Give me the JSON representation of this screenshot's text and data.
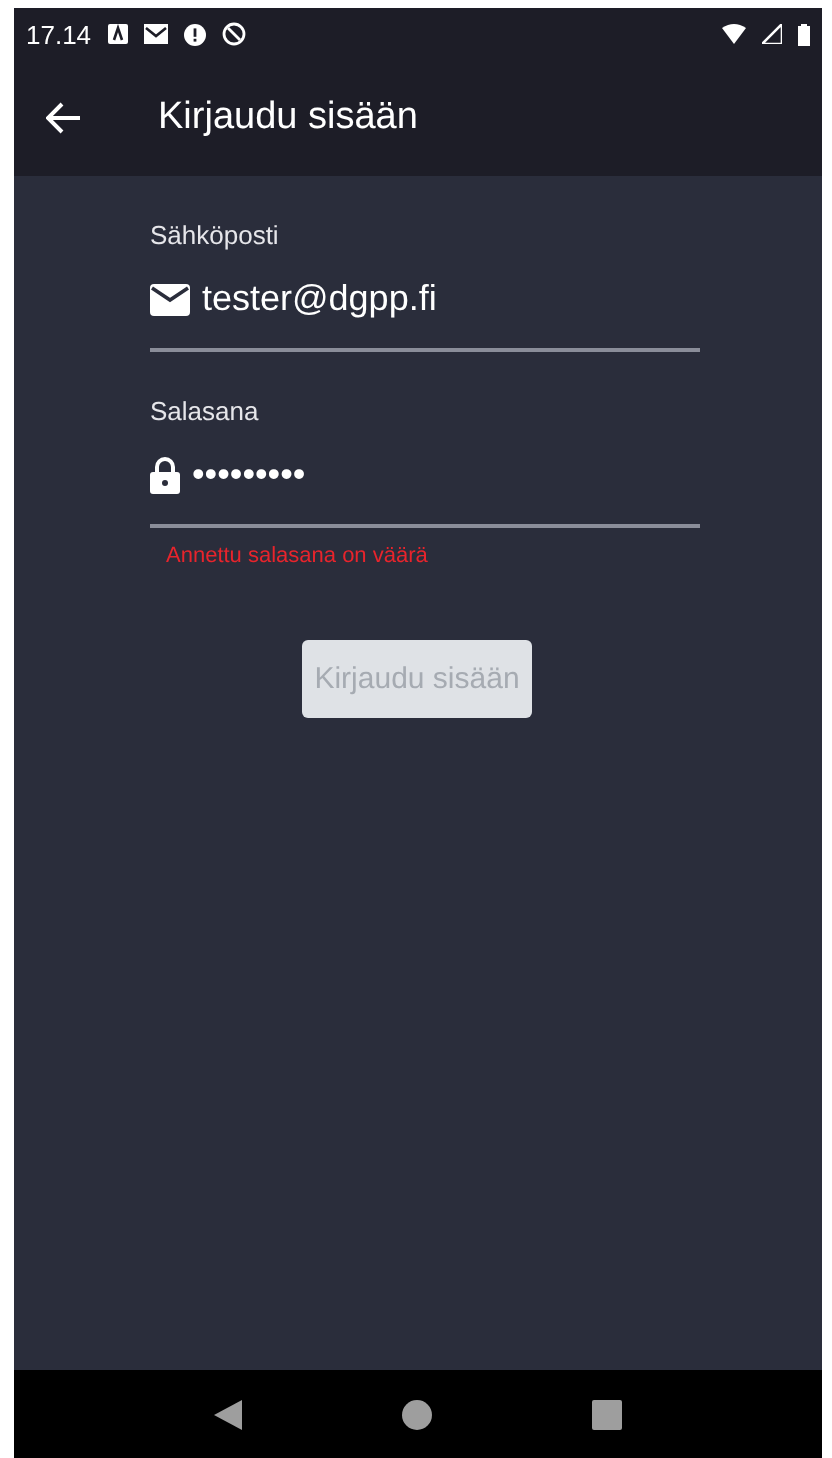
{
  "status_bar": {
    "time": "17.14"
  },
  "app_bar": {
    "title": "Kirjaudu sisään"
  },
  "form": {
    "fields": [
      {
        "kind": "email",
        "label": "Sähköposti",
        "value": "tester@dgpp.fi"
      },
      {
        "kind": "password",
        "label": "Salasana",
        "value": "•••••••••",
        "error": "Annettu salasana on väärä"
      }
    ],
    "submit": {
      "label": "Kirjaudu sisään",
      "disabled": true
    }
  }
}
